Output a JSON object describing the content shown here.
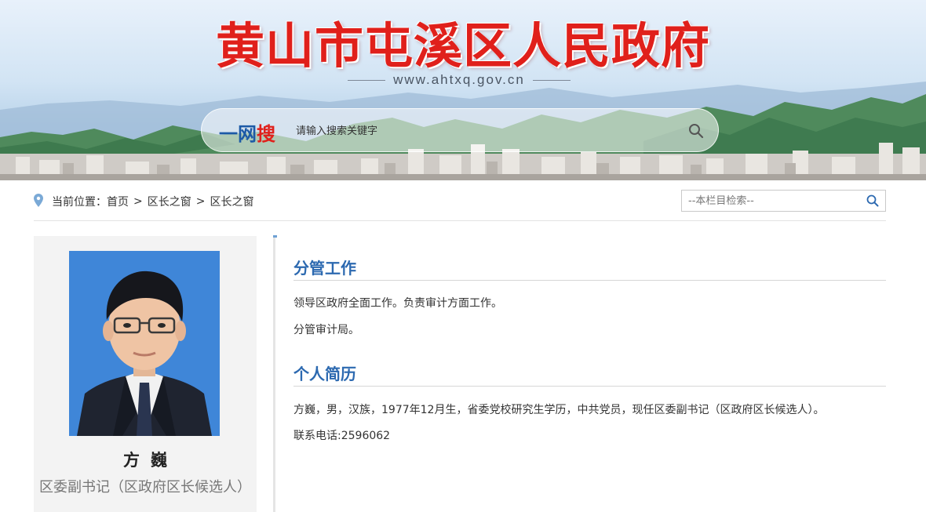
{
  "header": {
    "site_title": "黄山市屯溪区人民政府",
    "site_url": "www.ahtxq.gov.cn",
    "search": {
      "logo_part1": "一网",
      "logo_part2": "搜",
      "placeholder": "请输入搜索关键字",
      "search_icon": "search-icon"
    }
  },
  "breadcrumb": {
    "location_icon": "map-pin-icon",
    "prefix": "当前位置：",
    "items": [
      "首页",
      "区长之窗",
      "区长之窗"
    ],
    "separator": ">"
  },
  "column_search": {
    "placeholder": "--本栏目检索--",
    "search_icon": "search-icon"
  },
  "profile": {
    "name": "方巍",
    "title": "区委副书记（区政府区长候选人）"
  },
  "sections": [
    {
      "heading": "分管工作",
      "paragraphs": [
        "领导区政府全面工作。负责审计方面工作。",
        "分管审计局。"
      ]
    },
    {
      "heading": "个人简历",
      "paragraphs": [
        "方巍，男，汉族，1977年12月生，省委党校研究生学历，中共党员，现任区委副书记（区政府区长候选人）。",
        "联系电话:2596062"
      ]
    }
  ],
  "colors": {
    "title_red": "#e0201b",
    "heading_blue": "#2c69b0",
    "logo_blue": "#1c5aa6"
  }
}
